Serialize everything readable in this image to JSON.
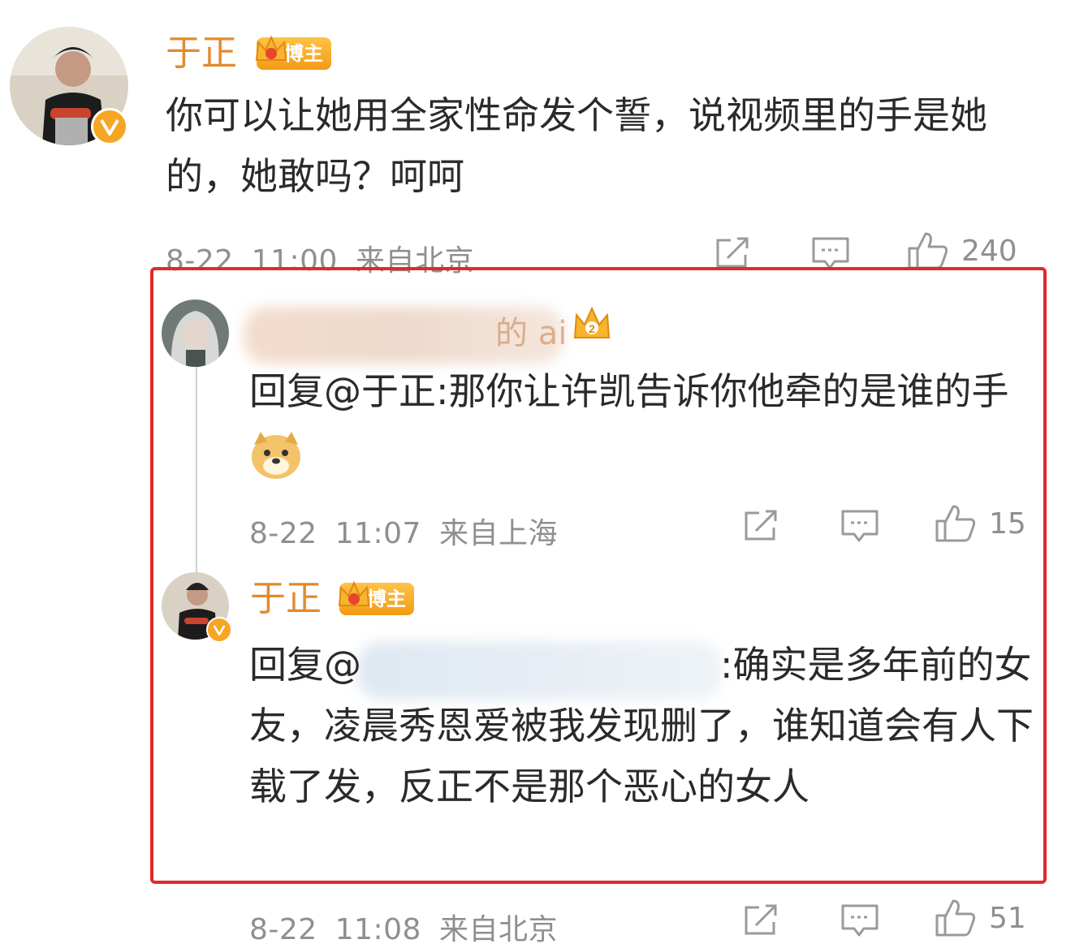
{
  "main_comment": {
    "author": "于正",
    "badge_label": "博主",
    "text": "你可以让她用全家性命发个誓，说视频里的手是她的，她敢吗？呵呵",
    "date": "8-22",
    "time": "11:00",
    "location": "来自北京",
    "likes": "240"
  },
  "reply1": {
    "author_visible_fragment": "的 ai",
    "reply_prefix": "回复",
    "mention": "@于正",
    "text": ":那你让许凯告诉你他牵的是谁的手",
    "date": "8-22",
    "time": "11:07",
    "location": "来自上海",
    "likes": "15"
  },
  "reply2": {
    "author": "于正",
    "badge_label": "博主",
    "reply_prefix": "回复",
    "mention_visible": "@",
    "text": ":确实是多年前的女友，凌晨秀恩爱被我发现删了，谁知道会有人下载了发，反正不是那个恶心的女人",
    "date": "8-22",
    "time": "11:08",
    "location": "来自北京",
    "likes": "51"
  },
  "colors": {
    "name": "#e38a2c",
    "highlight_box": "#e02a2a",
    "meta": "#8f8f8f",
    "badge": "#f6a623"
  },
  "icons": [
    "share-icon",
    "comment-icon",
    "like-icon",
    "verified-v-icon",
    "crown-icon",
    "doge-emoji-icon"
  ]
}
